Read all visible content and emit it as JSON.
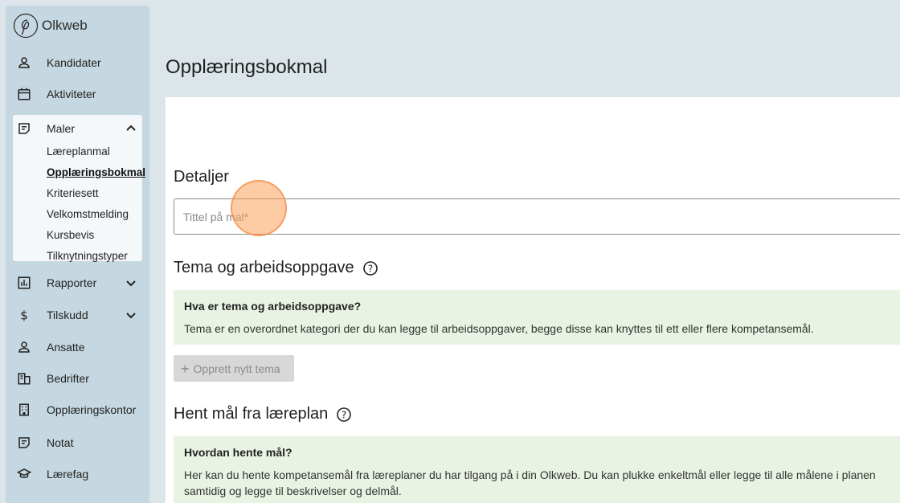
{
  "app": {
    "name": "Olkweb"
  },
  "sidebar": {
    "items": [
      {
        "label": "Kandidater",
        "icon": "person-icon"
      },
      {
        "label": "Aktiviteter",
        "icon": "calendar-icon"
      },
      {
        "label": "Maler",
        "icon": "template-icon",
        "expanded": true
      },
      {
        "label": "Rapporter",
        "icon": "report-icon"
      },
      {
        "label": "Tilskudd",
        "icon": "dollar-icon"
      },
      {
        "label": "Ansatte",
        "icon": "person-icon"
      },
      {
        "label": "Bedrifter",
        "icon": "building-icon"
      },
      {
        "label": "Opplæringskontor",
        "icon": "office-icon"
      },
      {
        "label": "Notat",
        "icon": "note-icon"
      },
      {
        "label": "Lærefag",
        "icon": "school-icon"
      }
    ],
    "maler_sub": [
      "Læreplanmal",
      "Opplæringsbokmal",
      "Kriteriesett",
      "Velkomstmelding",
      "Kursbevis",
      "Tilknytningstyper"
    ],
    "active_sub": "Opplæringsbokmal"
  },
  "main": {
    "title": "Opplæringsbokmal",
    "details_heading": "Detaljer",
    "title_input": {
      "placeholder": "Tittel på mal*",
      "value": ""
    },
    "theme_section": {
      "heading": "Tema og arbeidsoppgave",
      "info_question": "Hva er tema og arbeidsoppgave?",
      "info_answer": "Tema er en overordnet kategori der du kan legge til arbeidsoppgaver, begge disse kan knyttes til ett eller flere kompetansemål.",
      "button_label": "Opprett nytt tema"
    },
    "fetch_section": {
      "heading": "Hent mål fra læreplan",
      "info_question": "Hvordan hente mål?",
      "info_answer": "Her kan du hente kompetansemål fra læreplaner du har tilgang på i din Olkweb. Du kan plukke enkeltmål eller legge til alle målene i planen samtidig og legge til beskrivelser og delmål."
    }
  },
  "colors": {
    "background": "#dbe5ea",
    "sidebar": "#c5d7e0",
    "info_bg": "#e8f3e3",
    "marker": "#fca05a"
  }
}
